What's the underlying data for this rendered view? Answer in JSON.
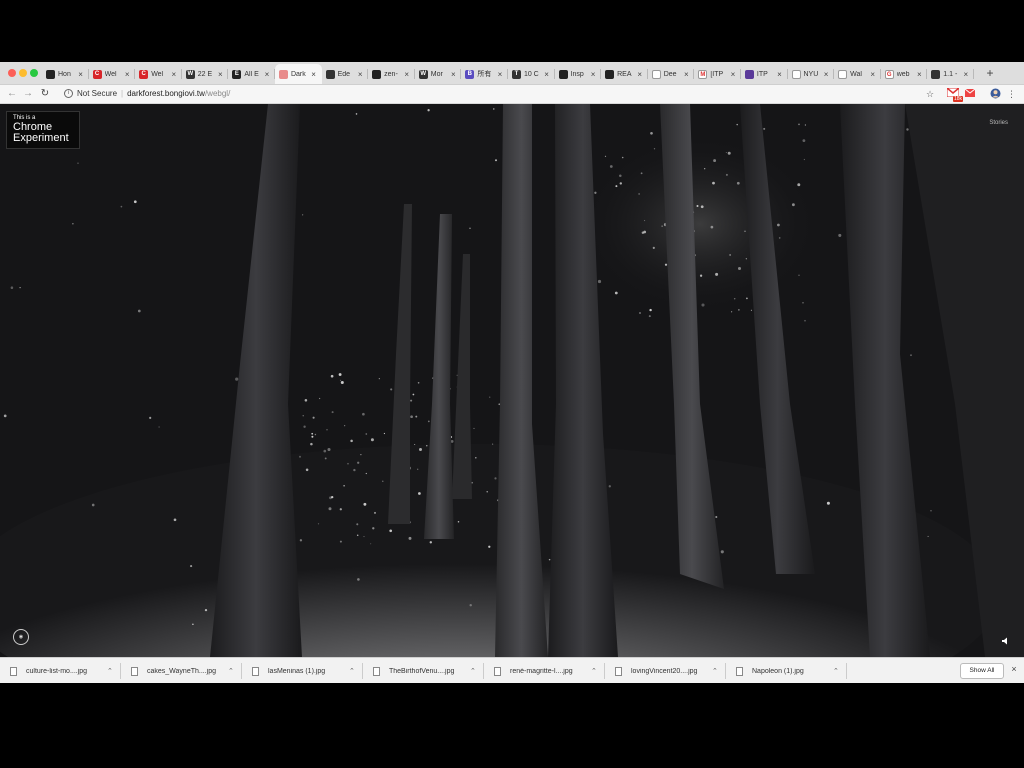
{
  "tabs": [
    {
      "title": "Hon",
      "icon": "github-icon",
      "color": "#222222",
      "glyph": ""
    },
    {
      "title": "Wel",
      "icon": "c-logo-icon",
      "color": "#d8262a",
      "glyph": "C"
    },
    {
      "title": "Wel",
      "icon": "c-logo-icon",
      "color": "#d8262a",
      "glyph": "C"
    },
    {
      "title": "22 E",
      "icon": "w-logo-icon",
      "color": "#333333",
      "glyph": "W"
    },
    {
      "title": "All E",
      "icon": "e-logo-icon",
      "color": "#222222",
      "glyph": "E"
    },
    {
      "title": "Dark",
      "icon": "circle-icon",
      "color": "#e88a8a",
      "glyph": ""
    },
    {
      "title": "Ede",
      "icon": "dot-icon",
      "color": "#333333",
      "glyph": ""
    },
    {
      "title": "zen-",
      "icon": "github-icon",
      "color": "#222222",
      "glyph": ""
    },
    {
      "title": "Mor",
      "icon": "w-logo-icon",
      "color": "#333333",
      "glyph": "W"
    },
    {
      "title": "所有",
      "icon": "b-logo-icon",
      "color": "#5a4cc0",
      "glyph": "B"
    },
    {
      "title": "10 C",
      "icon": "t-logo-icon",
      "color": "#333333",
      "glyph": "T"
    },
    {
      "title": "Insp",
      "icon": "github-icon",
      "color": "#222222",
      "glyph": ""
    },
    {
      "title": "REA",
      "icon": "crown-icon",
      "color": "#222222",
      "glyph": ""
    },
    {
      "title": "Dee",
      "icon": "page-icon",
      "color": "#ffffff",
      "glyph": ""
    },
    {
      "title": "[ITP",
      "icon": "gmail-icon",
      "color": "#ffffff",
      "glyph": "M"
    },
    {
      "title": "ITP",
      "icon": "itp-icon",
      "color": "#5b3a9a",
      "glyph": ""
    },
    {
      "title": "NYU",
      "icon": "page-icon",
      "color": "#ffffff",
      "glyph": ""
    },
    {
      "title": "Wal",
      "icon": "page-icon",
      "color": "#ffffff",
      "glyph": ""
    },
    {
      "title": "web",
      "icon": "google-icon",
      "color": "#ffffff",
      "glyph": "G"
    },
    {
      "title": "1.1 -",
      "icon": "doc-icon",
      "color": "#333333",
      "glyph": ""
    }
  ],
  "active_tab_index": 5,
  "address": {
    "security": "Not Secure",
    "host": "darkforest.bongiovi.tw",
    "path": "/webgl/"
  },
  "toolbar": {
    "gmail_badge": "18k"
  },
  "page": {
    "badge_small": "This is a",
    "badge_line1": "Chrome",
    "badge_line2": "Experiment",
    "stories": "Stories"
  },
  "downloads": {
    "items": [
      "culture-list-mo....jpg",
      "cakes_WayneTh....jpg",
      "lasMeninas (1).jpg",
      "TheBirthofVenu....jpg",
      "rené-magritte-l....jpg",
      "lovingVincent20....jpg",
      "Napoleon (1).jpg"
    ],
    "show_all": "Show All"
  }
}
